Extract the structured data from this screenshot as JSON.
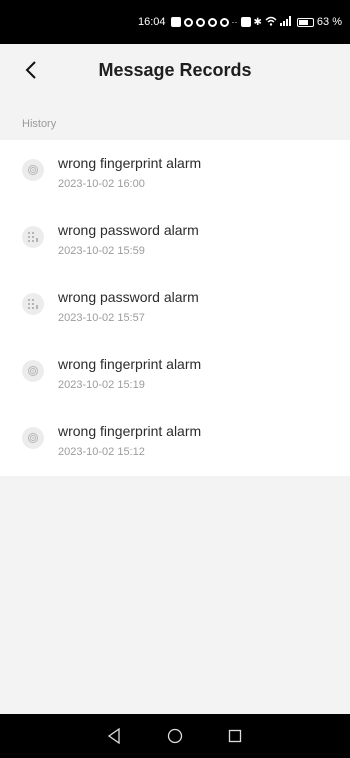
{
  "status_bar": {
    "time": "16:04",
    "dots": "··",
    "battery": "63 %"
  },
  "header": {
    "title": "Message Records",
    "back_icon": "chevron-left-icon"
  },
  "section": {
    "label": "History"
  },
  "records": [
    {
      "title": "wrong fingerprint alarm",
      "time": "2023-10-02 16:00",
      "icon": "fingerprint-icon"
    },
    {
      "title": "wrong password alarm",
      "time": "2023-10-02 15:59",
      "icon": "keypad-icon"
    },
    {
      "title": "wrong password alarm",
      "time": "2023-10-02 15:57",
      "icon": "keypad-icon"
    },
    {
      "title": "wrong fingerprint alarm",
      "time": "2023-10-02 15:19",
      "icon": "fingerprint-icon"
    },
    {
      "title": "wrong fingerprint alarm",
      "time": "2023-10-02 15:12",
      "icon": "fingerprint-icon"
    }
  ],
  "colors": {
    "background": "#f3f3f4",
    "card": "#ffffff",
    "text": "#2c2c2c",
    "muted": "#9c9c9c"
  },
  "nav_bar": {
    "buttons": [
      "back-triangle-icon",
      "home-circle-icon",
      "recents-square-icon"
    ]
  }
}
